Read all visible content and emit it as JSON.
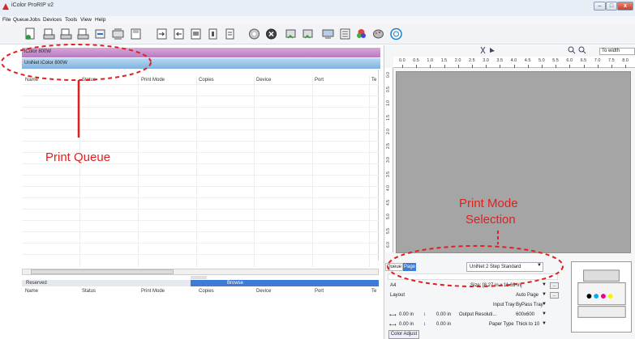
{
  "window": {
    "title": "iColor ProRIP v2",
    "min_glyph": "–",
    "max_glyph": "□",
    "close_glyph": "x"
  },
  "menubar": [
    "File",
    "Queue",
    "Jobs",
    "Devices",
    "Tools",
    "View",
    "Help"
  ],
  "toolbar": {
    "icons": [
      "new-job-icon",
      "print-icon",
      "print-icon",
      "print-icon",
      "hold-icon",
      "queue-icon",
      "save-icon",
      "import-icon",
      "export-icon",
      "duplicate-icon",
      "rip-icon",
      "settings-icon",
      "delete-icon",
      "route-icon",
      "route-icon",
      "network-icon",
      "list-icon",
      "paint-icon",
      "palette-icon",
      "help-icon"
    ]
  },
  "printers": {
    "tab1": "iColor 800W",
    "tab2": "UniNet iColor 800W"
  },
  "queue": {
    "columns": [
      "Name",
      "Status",
      "Print Mode",
      "Copies",
      "Device",
      "Port",
      "Te"
    ]
  },
  "reserved": {
    "title": "Reserved",
    "browse_label": "Browse",
    "columns": [
      "Name",
      "Status",
      "Print Mode",
      "Copies",
      "Device",
      "Port",
      "Te"
    ]
  },
  "preview": {
    "zoom_value": "To width",
    "ruler_x": [
      "0.0",
      "0.5",
      "1.0",
      "1.5",
      "2.0",
      "2.5",
      "3.0",
      "3.5",
      "4.0",
      "4.5",
      "5.0",
      "5.5",
      "6.0",
      "6.5",
      "7.0",
      "7.5",
      "8.0"
    ],
    "ruler_y": [
      "0.0",
      "0.5",
      "1.0",
      "1.5",
      "2.0",
      "2.5",
      "3.0",
      "3.5",
      "4.0",
      "4.5",
      "5.0",
      "5.5",
      "6.0"
    ]
  },
  "page_settings": {
    "tab_queue": "Queue",
    "tab_page": "Page",
    "print_mode": "UniNet 2 Step Standard",
    "paper": "A4",
    "size_label": "Size: [8.27 in x 11.69 in]",
    "layout_label": "Layout",
    "layout_value": "Auto Page",
    "input_tray_label": "Input Tray",
    "input_tray_value": "ByPass Tray",
    "offset1": "0.00 in",
    "offset2": "0.00 in",
    "offset3": "0.00 in",
    "offset4": "0.00 in",
    "output_res_label": "Output Resoluti...",
    "output_res_value": "600x600",
    "paper_type_label": "Paper Type",
    "paper_type_value": "Thick to 10",
    "color_adjust": "Color Adjust",
    "ellipsis": "..."
  },
  "annotations": {
    "print_queue": "Print Queue",
    "print_mode_line1": "Print Mode",
    "print_mode_line2": "Selection",
    "color": "#e02020"
  }
}
